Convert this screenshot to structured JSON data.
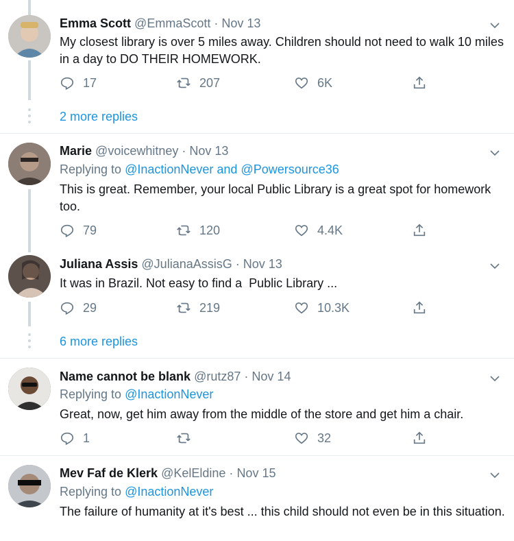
{
  "tweets": [
    {
      "name": "Emma Scott",
      "handle": "@EmmaScott",
      "date": "Nov 13",
      "text": "My closest library is over 5 miles away. Children should not need to walk 10 miles in a day to DO THEIR HOMEWORK.",
      "replies": "17",
      "retweets": "207",
      "likes": "6K",
      "avatar_color": "#b9b7b4"
    },
    {
      "name": "Marie",
      "handle": "@voicewhitney",
      "date": "Nov 13",
      "replying_prefix": "Replying to ",
      "replying_to": "@InactionNever and @Powersource36",
      "text": "This is great. Remember, your local Public Library is a great spot for homework too.",
      "replies": "79",
      "retweets": "120",
      "likes": "4.4K",
      "avatar_color": "#6f635c"
    },
    {
      "name": "Juliana Assis",
      "handle": "@JulianaAssisG",
      "date": "Nov 13",
      "text": "It was in Brazil. Not easy to find a  Public Library ...",
      "replies": "29",
      "retweets": "219",
      "likes": "10.3K",
      "avatar_color": "#8a7a70"
    },
    {
      "name": "Name cannot be blank",
      "handle": "@rutz87",
      "date": "Nov 14",
      "replying_prefix": "Replying to ",
      "replying_to": "@InactionNever",
      "text": "Great, now, get him away from the middle of the store and get him a chair.",
      "replies": "1",
      "retweets": "",
      "likes": "32",
      "avatar_color": "#3d3a38"
    },
    {
      "name": "Mev Faf de Klerk",
      "handle": "@KelEldine",
      "date": "Nov 15",
      "replying_prefix": "Replying to ",
      "replying_to": "@InactionNever",
      "text": "The failure of humanity at it's best ... this child should not even be in this situation.",
      "avatar_color": "#5b6168"
    }
  ],
  "more_replies": [
    "2 more replies",
    "6 more replies"
  ],
  "separator": "·",
  "colors": {
    "link": "#1b95e0",
    "muted": "#657786",
    "text": "#14171a",
    "line": "#cfd9de"
  }
}
